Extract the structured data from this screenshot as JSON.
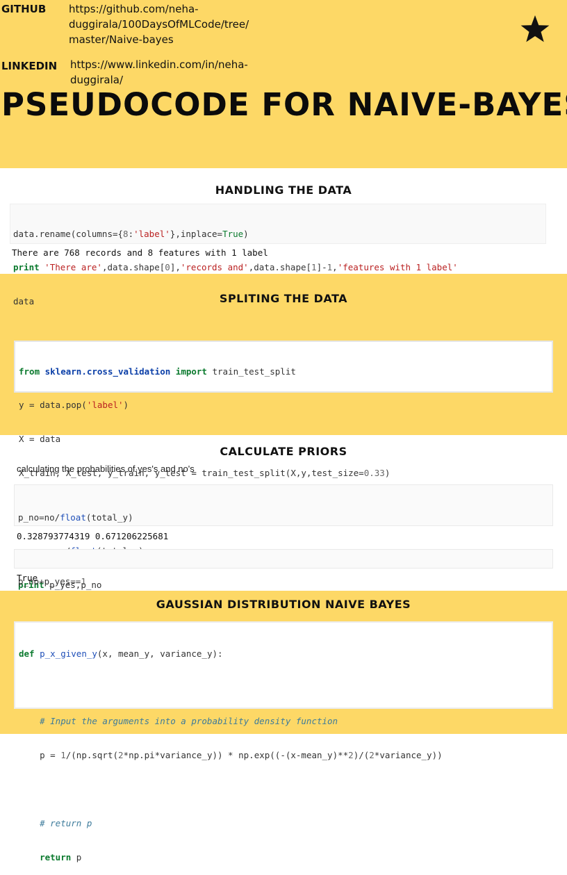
{
  "header": {
    "github_label": "GITHUB",
    "github_url_lines": [
      "https://github.com/neha-",
      "duggirala/100DaysOfMLCode/tree/",
      "master/Naive-bayes"
    ],
    "linkedin_label": "LINKEDIN",
    "linkedin_url_lines": [
      "https://www.linkedin.com/in/neha-",
      "duggirala/"
    ],
    "icon": "star-icon",
    "title": "PSEUDOCODE FOR NAIVE-BAYES"
  },
  "sections": {
    "handling": {
      "title": "HANDLING THE DATA",
      "code_lines": [
        "data.rename(columns={8:'label'},inplace=True)",
        "print 'There are',data.shape[0],'records and',data.shape[1]-1,'features with 1 label'",
        "data"
      ],
      "output": "There are 768 records and 8 features with 1 label"
    },
    "splitting": {
      "title": "SPLITING THE DATA",
      "code_lines": [
        "from sklearn.cross_validation import train_test_split",
        "y = data.pop('label')",
        "X = data",
        "X_train, X_test, y_train, y_test = train_test_split(X,y,test_size=0.33)"
      ]
    },
    "priors": {
      "title": "CALCULATE PRIORS",
      "note": "calculating the probabilities of yes's and no's",
      "code_lines": [
        "p_no=no/float(total_y)",
        "p_yes=yes/float(total_y)",
        "print p_yes,p_no"
      ],
      "output": "0.328793774319 0.671206225681",
      "check_line": "p_no+p_yes==1",
      "check_output": "True"
    },
    "gaussian": {
      "title": "GAUSSIAN DISTRIBUTION NAIVE BAYES",
      "code_lines": [
        "def p_x_given_y(x, mean_y, variance_y):",
        "",
        "    # Input the arguments into a probability density function",
        "    p = 1/(np.sqrt(2*np.pi*variance_y)) * np.exp((-(x-mean_y)**2)/(2*variance_y))",
        "",
        "    # return p",
        "    return p"
      ]
    }
  },
  "colors": {
    "yellow": "#fdd866",
    "white": "#ffffff",
    "keyword": "#0b7a2e",
    "string": "#ba2121",
    "comment": "#3d7b9b"
  }
}
